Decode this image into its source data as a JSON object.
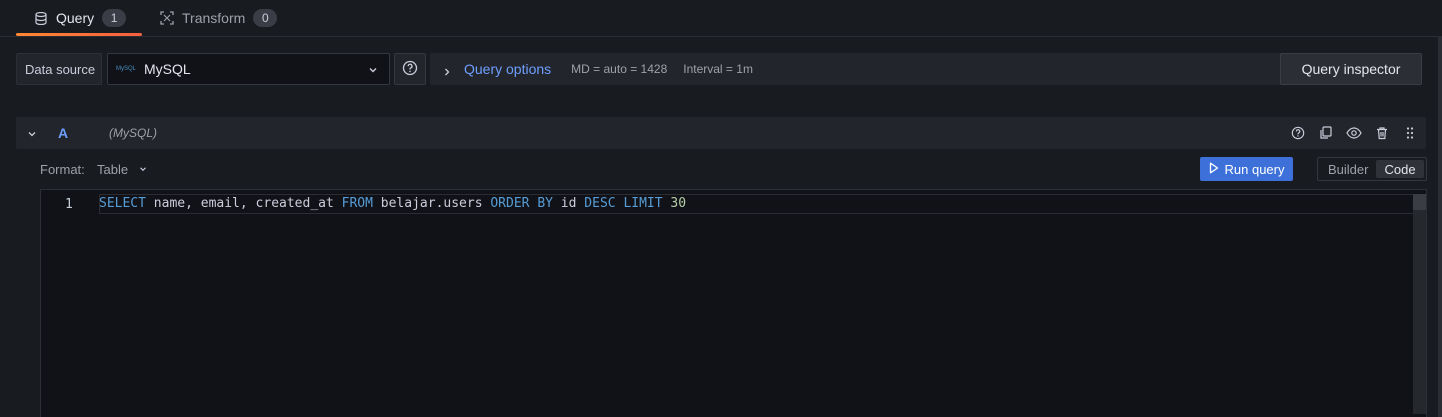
{
  "tabs": [
    {
      "label": "Query",
      "count": "1",
      "icon": "database-icon"
    },
    {
      "label": "Transform",
      "count": "0",
      "icon": "transform-icon"
    }
  ],
  "datasource": {
    "label": "Data source",
    "logo_text": "MySQL",
    "name": "MySQL"
  },
  "query_options": {
    "title": "Query options",
    "md": "MD = auto = 1428",
    "interval": "Interval = 1m"
  },
  "inspector_label": "Query inspector",
  "query": {
    "ref_id": "A",
    "ds_name": "(MySQL)",
    "format_label": "Format:",
    "format_value": "Table",
    "run_label": "Run query",
    "modes": [
      "Builder",
      "Code"
    ],
    "active_mode": "Code",
    "line_number": "1",
    "sql_tokens": [
      {
        "t": "SELECT",
        "kw": true
      },
      {
        "t": " name, email, created_at ",
        "kw": false
      },
      {
        "t": "FROM",
        "kw": true
      },
      {
        "t": " belajar.users ",
        "kw": false
      },
      {
        "t": "ORDER BY",
        "kw": true
      },
      {
        "t": " id ",
        "kw": false
      },
      {
        "t": "DESC",
        "kw": true
      },
      {
        "t": " ",
        "kw": false
      },
      {
        "t": "LIMIT",
        "kw": true
      },
      {
        "t": " ",
        "kw": false
      },
      {
        "t": "30",
        "num": true
      }
    ]
  },
  "colors": {
    "accent_blue": "#6e9fff",
    "run_button": "#3d71d9",
    "tab_underline": "#ff8833"
  }
}
